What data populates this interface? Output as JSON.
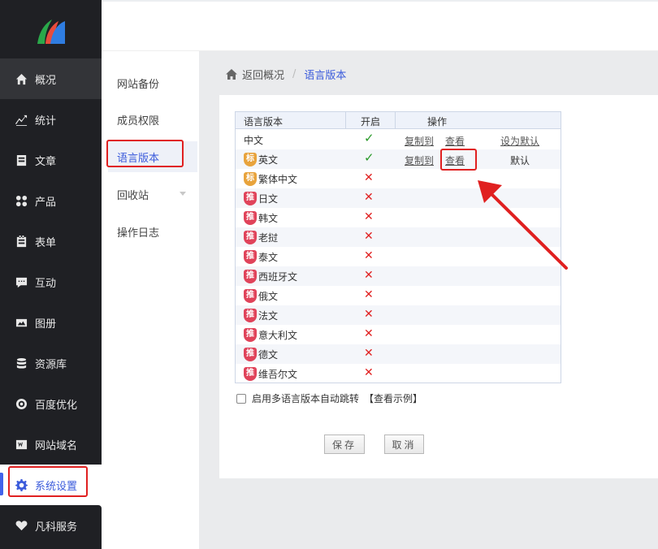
{
  "nav": {
    "items": [
      {
        "label": "概况",
        "icon": "home-icon"
      },
      {
        "label": "统计",
        "icon": "chart-icon"
      },
      {
        "label": "文章",
        "icon": "article-icon"
      },
      {
        "label": "产品",
        "icon": "product-icon"
      },
      {
        "label": "表单",
        "icon": "form-icon"
      },
      {
        "label": "互动",
        "icon": "chat-icon"
      },
      {
        "label": "图册",
        "icon": "album-icon"
      },
      {
        "label": "资源库",
        "icon": "database-icon"
      },
      {
        "label": "百度优化",
        "icon": "seo-icon"
      },
      {
        "label": "网站域名",
        "icon": "domain-icon"
      }
    ],
    "settings_label": "系统设置",
    "service_label": "凡科服务",
    "accent": "#3b5bdb"
  },
  "subnav": {
    "items": [
      "网站备份",
      "成员权限",
      "语言版本",
      "回收站",
      "操作日志"
    ],
    "active": "语言版本"
  },
  "breadcrumb": {
    "back": "返回概况",
    "separator": "/",
    "current": "语言版本"
  },
  "table": {
    "headers": {
      "lang": "语言版本",
      "enabled": "开启",
      "actions": "操作"
    },
    "rows": [
      {
        "badge": "",
        "name": "中文",
        "enabled": "✓",
        "copy": "复制到",
        "view": "查看",
        "default": "设为默认"
      },
      {
        "badge": "标",
        "name": "英文",
        "enabled": "✓",
        "copy": "复制到",
        "view": "查看",
        "default": "默认"
      },
      {
        "badge": "标",
        "name": "繁体中文",
        "enabled": "✕"
      },
      {
        "badge": "推",
        "name": "日文",
        "enabled": "✕"
      },
      {
        "badge": "推",
        "name": "韩文",
        "enabled": "✕"
      },
      {
        "badge": "推",
        "name": "老挝",
        "enabled": "✕"
      },
      {
        "badge": "推",
        "name": "泰文",
        "enabled": "✕"
      },
      {
        "badge": "推",
        "name": "西班牙文",
        "enabled": "✕"
      },
      {
        "badge": "推",
        "name": "俄文",
        "enabled": "✕"
      },
      {
        "badge": "推",
        "name": "法文",
        "enabled": "✕"
      },
      {
        "badge": "推",
        "name": "意大利文",
        "enabled": "✕"
      },
      {
        "badge": "推",
        "name": "德文",
        "enabled": "✕"
      },
      {
        "badge": "推",
        "name": "维吾尔文",
        "enabled": "✕"
      }
    ]
  },
  "auto_jump": {
    "label": "启用多语言版本自动跳转",
    "example": "【查看示例】",
    "checked": false
  },
  "buttons": {
    "save": "保存",
    "cancel": "取消"
  }
}
